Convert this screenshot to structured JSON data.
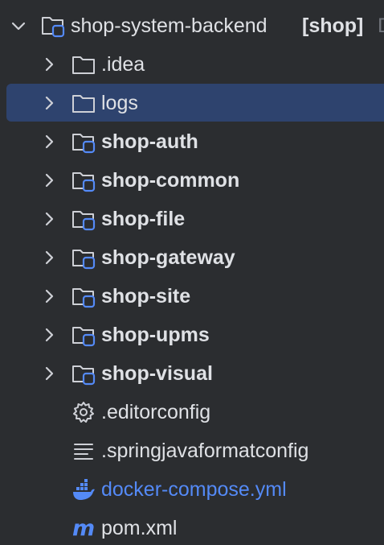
{
  "root": {
    "name": "shop-system-backend",
    "module": "[shop]",
    "trailing": "D"
  },
  "items": [
    {
      "label": ".idea",
      "kind": "folder",
      "bold": false
    },
    {
      "label": "logs",
      "kind": "folder",
      "bold": false,
      "selected": true
    },
    {
      "label": "shop-auth",
      "kind": "module",
      "bold": true
    },
    {
      "label": "shop-common",
      "kind": "module",
      "bold": true
    },
    {
      "label": "shop-file",
      "kind": "module",
      "bold": true
    },
    {
      "label": "shop-gateway",
      "kind": "module",
      "bold": true
    },
    {
      "label": "shop-site",
      "kind": "module",
      "bold": true
    },
    {
      "label": "shop-upms",
      "kind": "module",
      "bold": true
    },
    {
      "label": "shop-visual",
      "kind": "module",
      "bold": true
    },
    {
      "label": ".editorconfig",
      "kind": "gear-file",
      "bold": false
    },
    {
      "label": ".springjavaformatconfig",
      "kind": "text-file",
      "bold": false
    },
    {
      "label": "docker-compose.yml",
      "kind": "docker-file",
      "bold": false
    },
    {
      "label": "pom.xml",
      "kind": "maven-file",
      "bold": false
    }
  ],
  "colors": {
    "background": "#2b2d30",
    "selection": "#2e436e",
    "text": "#dfe1e5",
    "icon": "#ced0d6",
    "module_badge": "#548af7",
    "docker_label": "#548af7",
    "maven_icon": "#548af7"
  }
}
